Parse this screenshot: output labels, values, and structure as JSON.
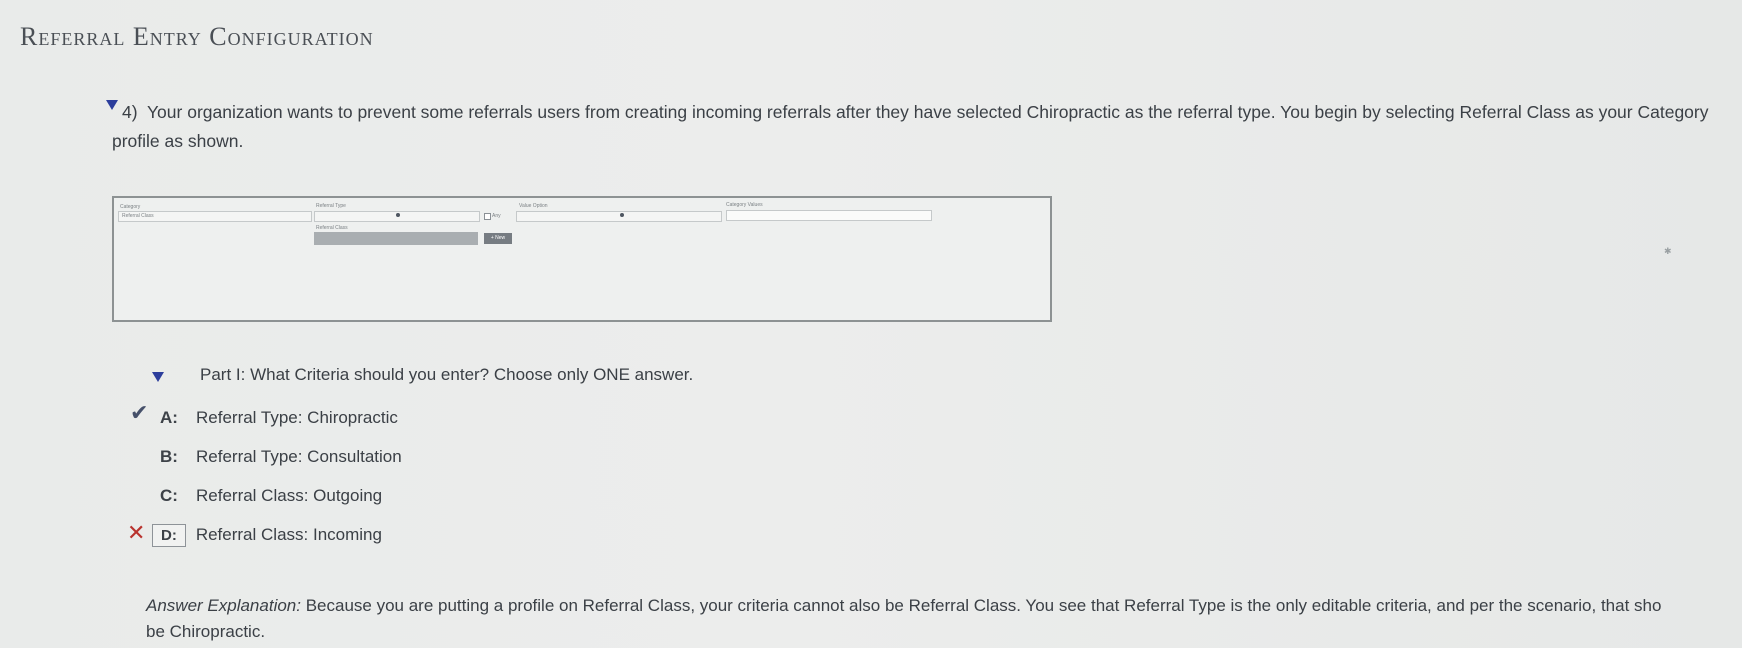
{
  "page_title": "Referral Entry Configuration",
  "question": {
    "number": "4)",
    "line1": "Your organization wants to prevent some referrals users from creating incoming referrals after they have selected Chiropractic as the referral type. You begin by selecting Referral Class as your Category",
    "line2": "profile as shown."
  },
  "mini_screenshot": {
    "category_label": "Category",
    "category_value": "Referral Class",
    "referral_type_label": "Referral Type",
    "any_label": "Any",
    "value_option_label": "Value Option",
    "category_values_label": "Category Values",
    "referral_class_label": "Referral Class",
    "button_label": "+ New"
  },
  "part": {
    "text": "Part I: What Criteria should you enter? Choose only ONE answer."
  },
  "options": [
    {
      "letter": "A:",
      "text": "Referral Type: Chiropractic",
      "state": "correct"
    },
    {
      "letter": "B:",
      "text": "Referral Type: Consultation",
      "state": "none"
    },
    {
      "letter": "C:",
      "text": "Referral Class: Outgoing",
      "state": "none"
    },
    {
      "letter": "D:",
      "text": "Referral Class: Incoming",
      "state": "selected-wrong"
    }
  ],
  "explanation": {
    "label": "Answer Explanation:",
    "line1": "Because you are putting a profile on Referral Class, your criteria cannot also be Referral Class. You see that Referral Type is the only editable criteria, and per the scenario, that sho",
    "line2": "be Chiropractic."
  },
  "colors": {
    "accent_arrow": "#2c3e9c",
    "wrong_mark": "#b9332e",
    "check_mark": "#46506a"
  }
}
